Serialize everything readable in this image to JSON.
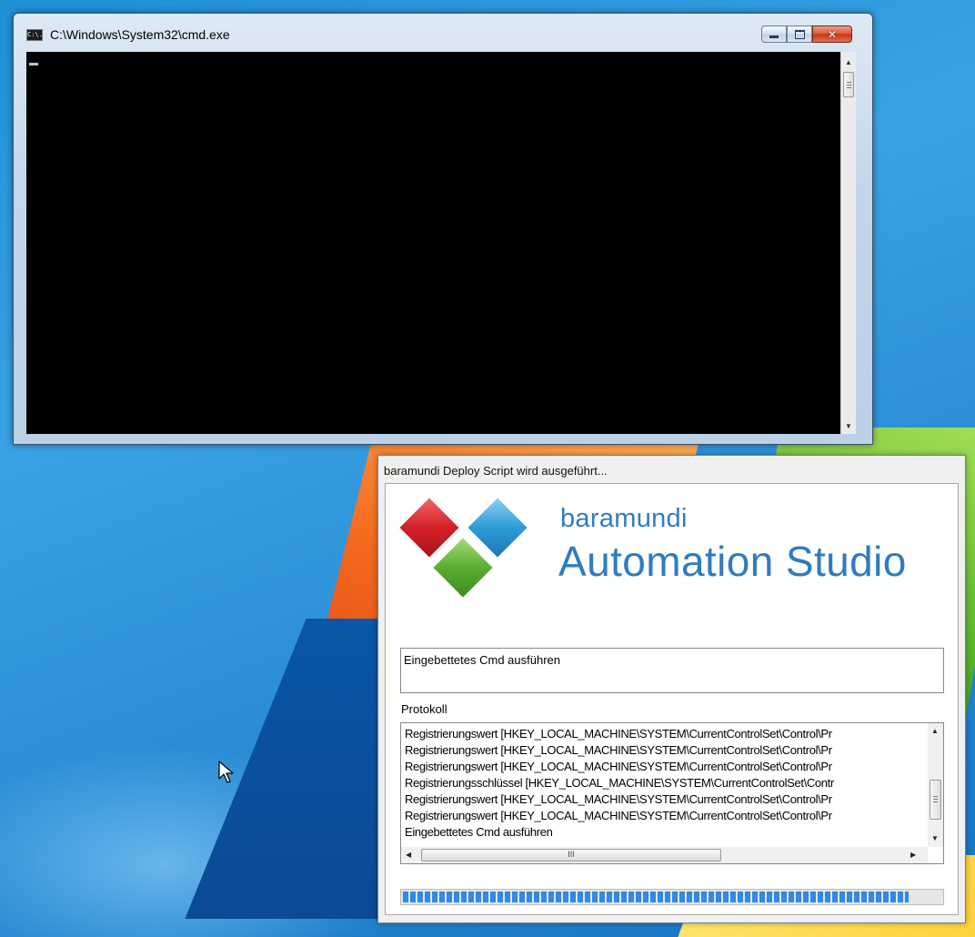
{
  "cmd_window": {
    "title": "C:\\Windows\\System32\\cmd.exe",
    "icon_text": "C:\\.",
    "close_glyph": "✕"
  },
  "baramundi_window": {
    "title": "baramundi Deploy Script wird ausgeführt...",
    "brand_small": "baramundi",
    "brand_large": "Automation Studio",
    "current_step": "Eingebettetes Cmd ausführen",
    "log_label": "Protokoll",
    "log_lines": [
      "Registrierungswert [HKEY_LOCAL_MACHINE\\SYSTEM\\CurrentControlSet\\Control\\Pr",
      "Registrierungswert [HKEY_LOCAL_MACHINE\\SYSTEM\\CurrentControlSet\\Control\\Pr",
      "Registrierungswert [HKEY_LOCAL_MACHINE\\SYSTEM\\CurrentControlSet\\Control\\Pr",
      "Registrierungsschlüssel [HKEY_LOCAL_MACHINE\\SYSTEM\\CurrentControlSet\\Contr",
      "Registrierungswert [HKEY_LOCAL_MACHINE\\SYSTEM\\CurrentControlSet\\Control\\Pr",
      "Registrierungswert [HKEY_LOCAL_MACHINE\\SYSTEM\\CurrentControlSet\\Control\\Pr",
      "Eingebettetes Cmd ausführen"
    ],
    "hscroll_grip": "III",
    "progress_percent": 94,
    "colors": {
      "brand_blue": "#2f7cc0",
      "logo_red": "#d42027",
      "logo_blue": "#2e9bd6",
      "logo_green": "#5bad32",
      "progress": "#2f8be6"
    }
  }
}
